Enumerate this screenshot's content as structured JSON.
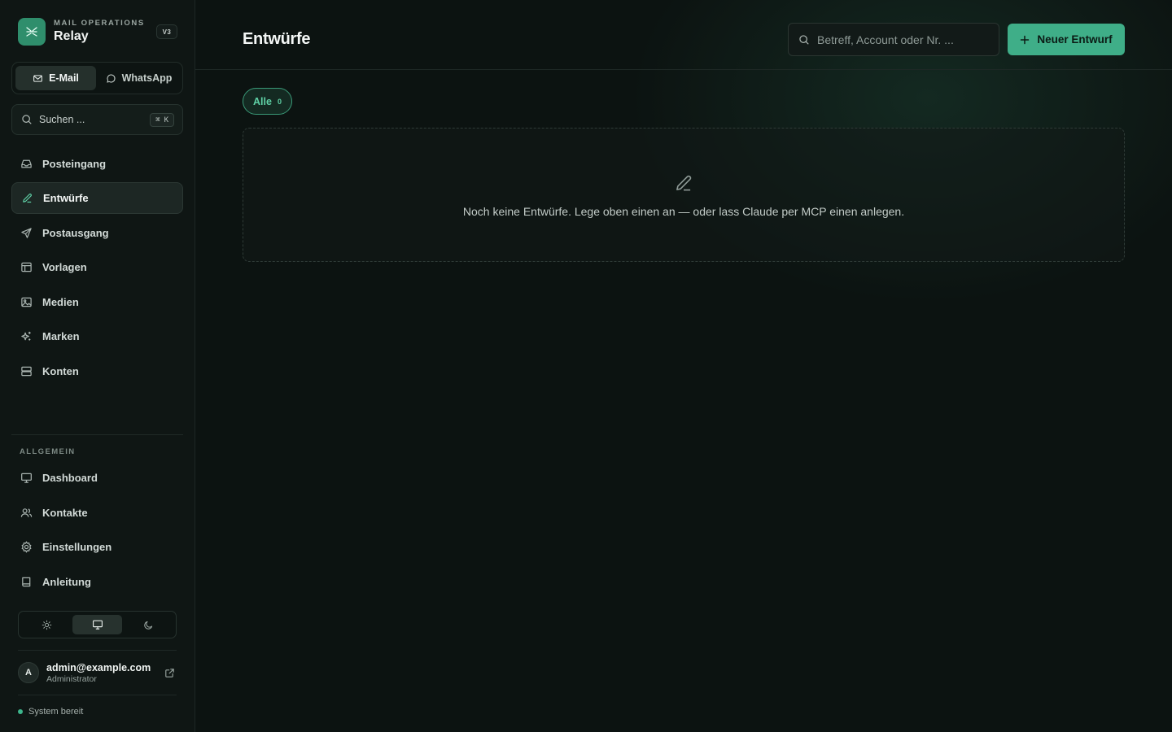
{
  "app": {
    "eyebrow": "MAIL OPERATIONS",
    "name": "Relay",
    "version": "V3"
  },
  "channels": [
    {
      "label": "E-Mail",
      "icon": "mail-icon",
      "active": true
    },
    {
      "label": "WhatsApp",
      "icon": "chat-bubble-icon",
      "active": false
    }
  ],
  "sidebar_search": {
    "label": "Suchen ...",
    "shortcut_symbol": "⌘",
    "shortcut_key": "K"
  },
  "nav": [
    {
      "label": "Posteingang",
      "icon": "inbox-icon",
      "active": false
    },
    {
      "label": "Entwürfe",
      "icon": "pencil-icon",
      "active": true
    },
    {
      "label": "Postausgang",
      "icon": "send-icon",
      "active": false
    },
    {
      "label": "Vorlagen",
      "icon": "template-icon",
      "active": false
    },
    {
      "label": "Medien",
      "icon": "image-icon",
      "active": false
    },
    {
      "label": "Marken",
      "icon": "sparkle-icon",
      "active": false
    },
    {
      "label": "Konten",
      "icon": "server-icon",
      "active": false
    }
  ],
  "general": {
    "title": "ALLGEMEIN",
    "items": [
      {
        "label": "Dashboard",
        "icon": "monitor-icon"
      },
      {
        "label": "Kontakte",
        "icon": "users-icon"
      },
      {
        "label": "Einstellungen",
        "icon": "gear-icon"
      },
      {
        "label": "Anleitung",
        "icon": "book-icon"
      }
    ]
  },
  "theme": {
    "options": [
      "light",
      "system",
      "dark"
    ],
    "selected": "system"
  },
  "user": {
    "initial": "A",
    "email": "admin@example.com",
    "role": "Administrator"
  },
  "status": {
    "text": "System bereit",
    "color": "#3db58c"
  },
  "header": {
    "title": "Entwürfe",
    "search_placeholder": "Betreff, Account oder Nr. ...",
    "new_button": "Neuer Entwurf"
  },
  "filters": [
    {
      "label": "Alle",
      "count": "0",
      "active": true
    }
  ],
  "empty_state": {
    "icon": "pencil-icon",
    "text": "Noch keine Entwürfe. Lege oben einen an — oder lass Claude per MCP einen anlegen."
  },
  "colors": {
    "accent": "#3fae88",
    "accent_text": "#5fd1a6",
    "background": "#0c1311",
    "sidebar": "#0f1614"
  }
}
